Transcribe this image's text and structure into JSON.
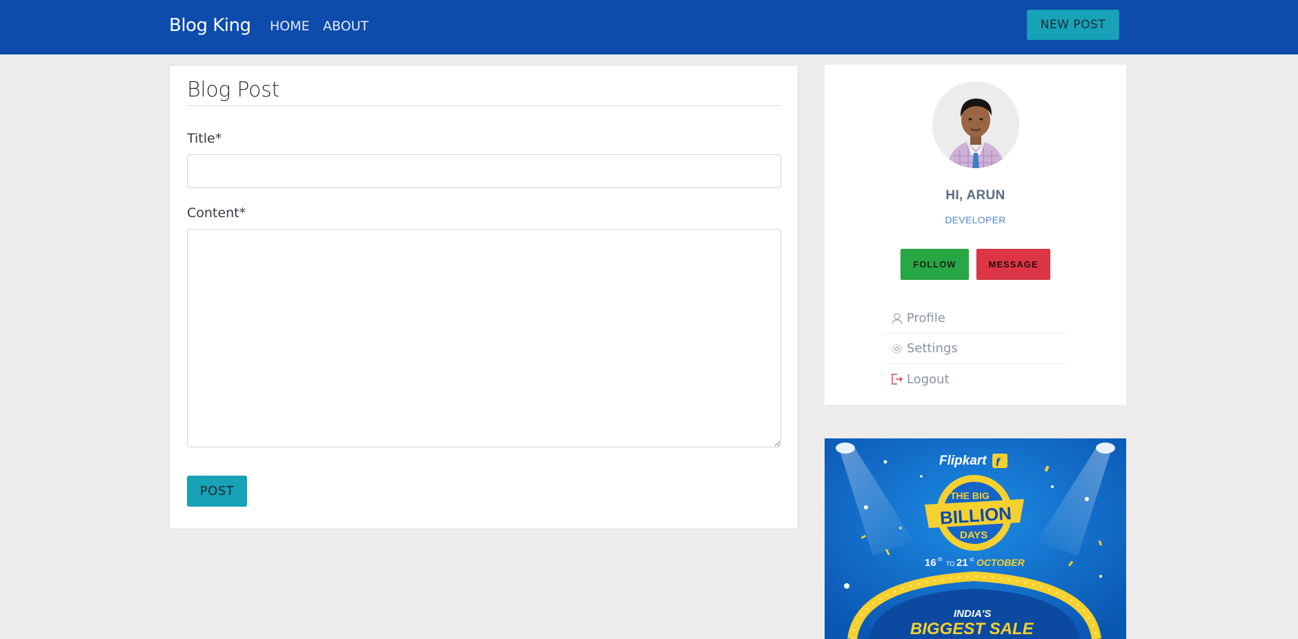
{
  "navbar": {
    "brand": "Blog King",
    "links": [
      "HOME",
      "ABOUT"
    ],
    "new_post_label": "NEW POST"
  },
  "form": {
    "heading": "Blog Post",
    "title_label": "Title*",
    "title_value": "",
    "content_label": "Content*",
    "content_value": "",
    "submit_label": "POST"
  },
  "profile": {
    "greeting": "HI, ARUN",
    "role": "DEVELOPER",
    "follow_label": "FOLLOW",
    "message_label": "MESSAGE",
    "menu": [
      {
        "label": "Profile",
        "icon": "user-icon"
      },
      {
        "label": "Settings",
        "icon": "gear-icon"
      },
      {
        "label": "Logout",
        "icon": "logout-icon"
      }
    ]
  },
  "ad": {
    "brand": "Flipkart",
    "headline_top": "THE BIG",
    "headline_main": "BILLION",
    "headline_bottom": "DAYS",
    "dates_from": "16",
    "dates_from_sup": "th",
    "dates_to_word": "TO",
    "dates_to": "21",
    "dates_to_sup": "st",
    "dates_month": "OCTOBER",
    "tagline_1": "INDIA'S",
    "tagline_2": "BIGGEST SALE"
  },
  "colors": {
    "navbar": "#0d4bad",
    "info": "#17a2b8",
    "success": "#28a745",
    "danger": "#dc3545",
    "background": "#edeceb"
  }
}
